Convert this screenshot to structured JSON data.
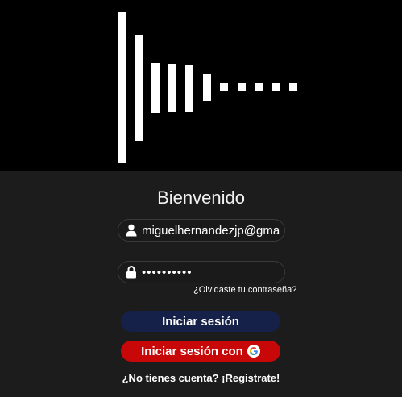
{
  "header": {
    "logo": "waveform-bars-logo"
  },
  "login": {
    "title": "Bienvenido",
    "user_icon": "user-icon",
    "username_value": "miguelhernandezjp@gmail.com",
    "lock_icon": "lock-icon",
    "password_value": "**********",
    "forgot_link": "¿Olvidaste tu contraseña?",
    "login_button": "Iniciar sesión",
    "google_button": "Iniciar sesión con",
    "google_icon": "google-icon",
    "register_link": "¿No tienes cuenta? ¡Registrate!"
  },
  "colors": {
    "background": "#1c1c1c",
    "hero": "#000000",
    "login_button": "#16214a",
    "google_button": "#c80808"
  }
}
